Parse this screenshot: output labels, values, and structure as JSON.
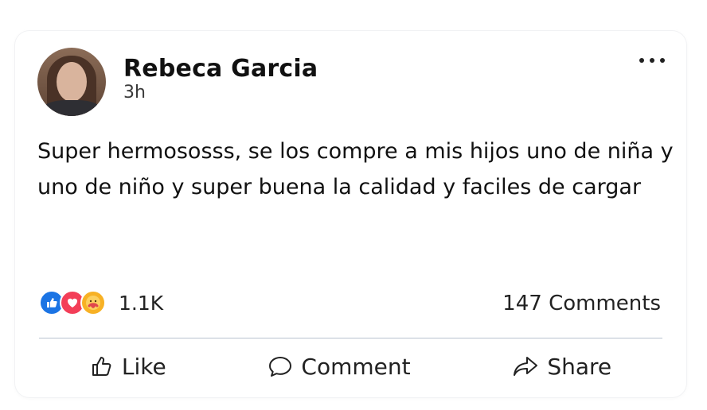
{
  "post": {
    "author": "Rebeca Garcia",
    "time": "3h",
    "text": "Super hermososss, se los compre a mis hijos uno de niña y uno de niño y super buena la calidad y faciles de cargar",
    "reactions": {
      "icons": [
        "like-icon",
        "love-icon",
        "care-icon"
      ],
      "count": "1.1K"
    },
    "comments_label": "147 Comments"
  },
  "actions": {
    "like_label": "Like",
    "comment_label": "Comment",
    "share_label": "Share"
  },
  "colors": {
    "like": "#1b74e4",
    "love": "#f33e58",
    "care": "#f7b125",
    "divider": "#b8c3cf"
  }
}
